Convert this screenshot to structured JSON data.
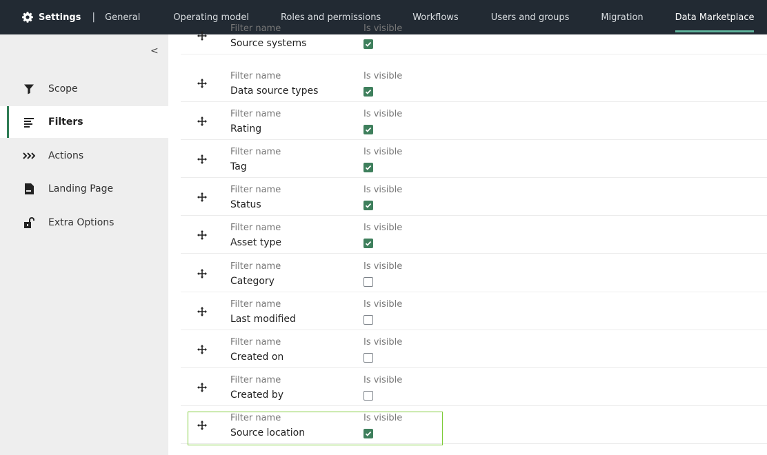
{
  "header": {
    "title": "Settings",
    "separator": "|",
    "tabs": [
      {
        "label": "General"
      },
      {
        "label": "Operating model"
      },
      {
        "label": "Roles and permissions"
      },
      {
        "label": "Workflows"
      },
      {
        "label": "Users and groups"
      },
      {
        "label": "Migration"
      },
      {
        "label": "Data Marketplace"
      }
    ],
    "active_tab": "Data Marketplace",
    "accent_color": "#5eb39b"
  },
  "sidebar": {
    "collapse_glyph": "<",
    "items": [
      {
        "label": "Scope",
        "icon": "filter-funnel-icon"
      },
      {
        "label": "Filters",
        "icon": "filter-lines-icon",
        "active": true
      },
      {
        "label": "Actions",
        "icon": "chevrons-right-icon"
      },
      {
        "label": "Landing Page",
        "icon": "document-icon"
      },
      {
        "label": "Extra Options",
        "icon": "unlocked-padlock-icon"
      }
    ]
  },
  "filters": {
    "name_label": "Filter name",
    "visible_label": "Is visible",
    "rows": [
      {
        "name": "Source systems",
        "visible": true
      },
      {
        "name": "Data source types",
        "visible": true
      },
      {
        "name": "Rating",
        "visible": true
      },
      {
        "name": "Tag",
        "visible": true
      },
      {
        "name": "Status",
        "visible": true
      },
      {
        "name": "Asset type",
        "visible": true
      },
      {
        "name": "Category",
        "visible": false
      },
      {
        "name": "Last modified",
        "visible": false
      },
      {
        "name": "Created on",
        "visible": false
      },
      {
        "name": "Created by",
        "visible": false
      },
      {
        "name": "Source location",
        "visible": true
      }
    ],
    "highlighted_row": "Source location"
  }
}
